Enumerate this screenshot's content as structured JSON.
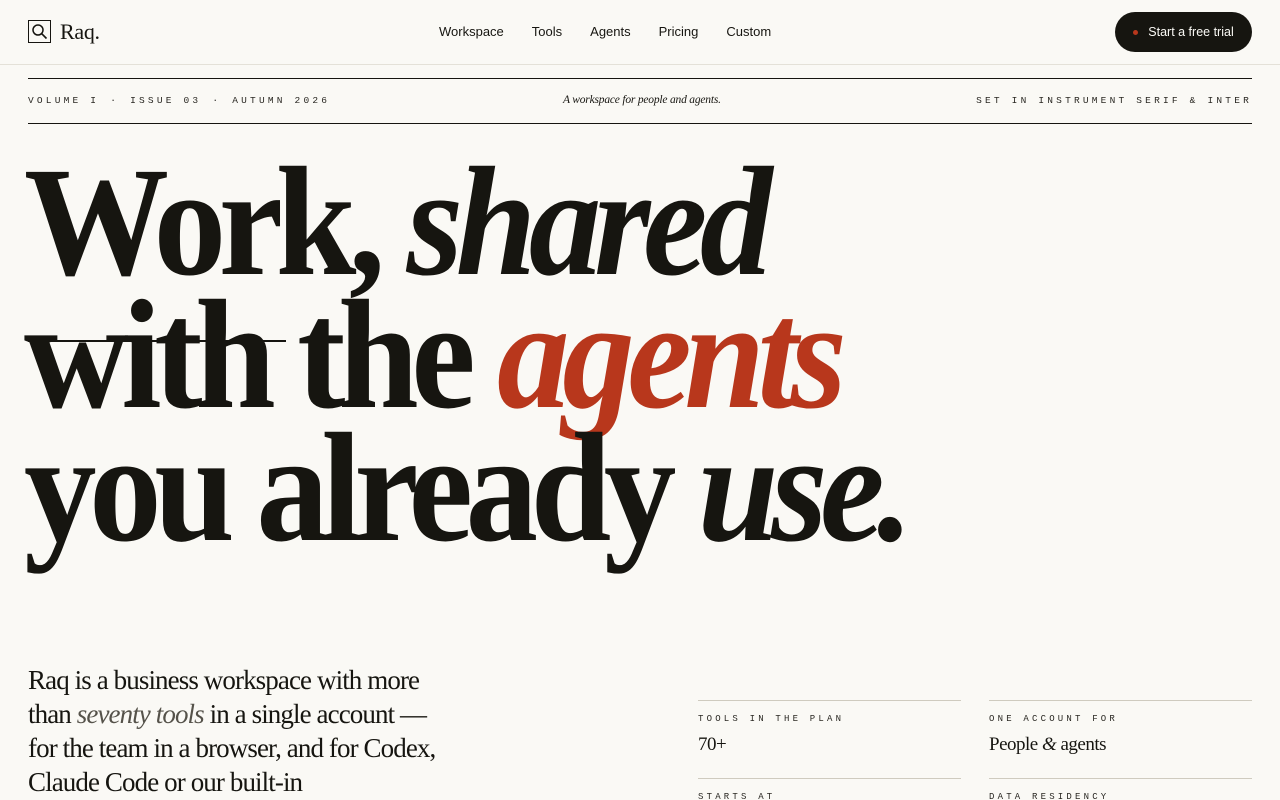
{
  "nav": {
    "logo_text": "Raq.",
    "logo_icon": "search-icon",
    "items": [
      "Workspace",
      "Tools",
      "Agents",
      "Pricing",
      "Custom"
    ],
    "cta_label": "Start a free trial"
  },
  "masthead": {
    "volume": "Volume I",
    "issue": "Issue 03",
    "season": "Autumn 2026",
    "separator": "·",
    "tagline": "A workspace for people and agents.",
    "typeset": "Set in Instrument Serif & Inter"
  },
  "hero": {
    "line1_a": "Work,",
    "line1_b": "shared",
    "line2_a": "with the",
    "line2_b": "agents",
    "line3_a": "you already",
    "line3_b": "use."
  },
  "intro": {
    "part1": "Raq is a business workspace with more than ",
    "emphasis": "seventy tools",
    "part2": " in a single account — for the team in a browser, and for Codex, Claude Code or our built-in Supercomputer through"
  },
  "stats": {
    "tools_label": "Tools in the plan",
    "tools_value": "70+",
    "account_label": "One account for",
    "account_value_a": "People",
    "account_value_amp": "&",
    "account_value_b": "agents",
    "starts_label": "Starts at",
    "residency_label": "Data residency"
  },
  "colors": {
    "background": "#faf9f5",
    "ink": "#161510",
    "accent": "#b8371c"
  }
}
